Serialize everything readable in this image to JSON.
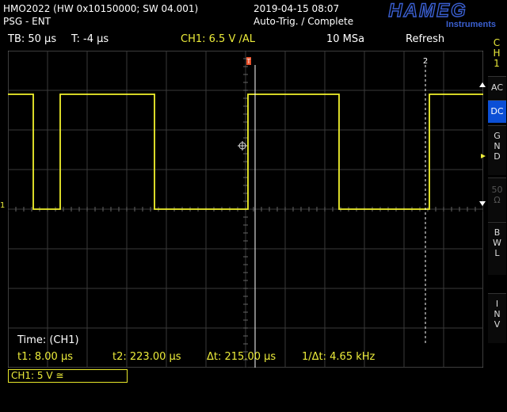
{
  "device": {
    "model_line": "HMO2022 (HW 0x10150000; SW 04.001)",
    "mode_line": "PSG - ENT",
    "timestamp": "2019-04-15 08:07",
    "trigger_status": "Auto-Trig. / Complete",
    "brand": "HAMEG",
    "brand_sub": "Instruments"
  },
  "topbar": {
    "timebase": "TB: 50 µs",
    "trigger_time": "T: -4 µs",
    "trigger_setting": "CH1: 6.5 V ∕AL",
    "sample_rate": "10 MSa",
    "acq_mode": "Refresh"
  },
  "sidebar": {
    "channel_label": "C H 1",
    "buttons": [
      {
        "label": "AC",
        "active": false
      },
      {
        "label": "DC",
        "active": true
      },
      {
        "label": "G N D",
        "active": false
      },
      {
        "label": "50 Ω",
        "active": false
      },
      {
        "label": "B W L",
        "active": false
      },
      {
        "label": "I N V",
        "active": false
      }
    ]
  },
  "cursors": {
    "title": "Time: (CH1)",
    "t1": "t1: 8.00 µs",
    "t2": "t2: 223.00 µs",
    "dt": "Δt: 215.00 µs",
    "inv_dt": "1/Δt: 4.65 kHz",
    "cursor1_label": "1",
    "cursor2_label": "2",
    "t1_us": 8,
    "t2_us": 223
  },
  "markers": {
    "ch1_ground_label": "1",
    "trigger_label": "T"
  },
  "channel_status": "CH1: 5 V ≅",
  "colors": {
    "trace": "#f2f22c",
    "grid": "#3a3a3a",
    "active_button": "#0b4fd6",
    "brand": "#3a5fd0",
    "trigger_marker": "#e8502a"
  },
  "chart_data": {
    "type": "line",
    "x_unit": "µs",
    "time_per_div_us": 50,
    "divisions_x": 12,
    "xlim": [
      -304,
      296
    ],
    "ylim": [
      -4,
      4
    ],
    "series": [
      {
        "x": [
          -304,
          -300,
          -300,
          -272,
          -272,
          -238,
          -238,
          -119,
          -119,
          -1,
          -1,
          114,
          114,
          228,
          228,
          296
        ],
        "y": [
          2.9,
          2.9,
          2.9,
          2.9,
          0,
          0,
          2.9,
          2.9,
          0,
          0,
          2.9,
          2.9,
          0,
          0,
          2.9,
          2.9
        ]
      }
    ]
  }
}
